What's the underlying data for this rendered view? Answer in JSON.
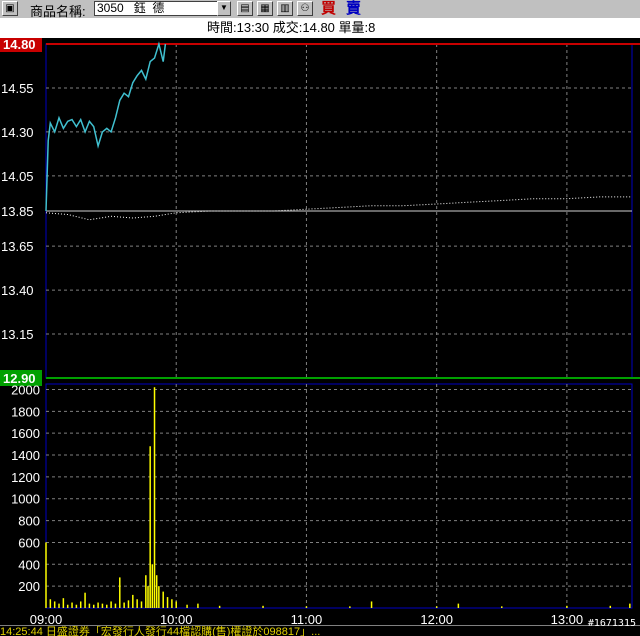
{
  "toolbar": {
    "label": "商品名稱:",
    "symbol_value": "3050   鈺  德",
    "buy_label": "買",
    "sell_label": "賣"
  },
  "info": {
    "text": "時間:13:30 成交:14.80 單量:8"
  },
  "ticker": {
    "text": "14:25:44 日盛證券「宏發行人發行44檔認購(售)權證於098817」..."
  },
  "watermark": "#1671315",
  "colors": {
    "upper_limit": "#c80000",
    "lower_limit": "#00a000",
    "price_line": "#40c0d0",
    "avg_line": "#ffffff",
    "volume": "#ffff00",
    "grid": "#808080"
  },
  "chart_data": [
    {
      "type": "line",
      "y_ticks": [
        "14.80",
        "14.55",
        "14.30",
        "14.05",
        "13.85",
        "13.65",
        "13.40",
        "13.15",
        "12.90"
      ],
      "ylim": [
        12.9,
        14.8
      ],
      "upper_limit": 14.8,
      "lower_limit": 12.9,
      "reference": 13.85,
      "x_ticks": [
        "09:00",
        "10:00",
        "11:00",
        "12:00",
        "13:00"
      ],
      "xlim": [
        "09:00",
        "13:30"
      ],
      "grid": true,
      "series": [
        {
          "x": [
            "09:00",
            "09:01",
            "09:02",
            "09:04",
            "09:06",
            "09:08",
            "09:10",
            "09:12",
            "09:14",
            "09:16",
            "09:18",
            "09:20",
            "09:22",
            "09:24",
            "09:26",
            "09:28",
            "09:30",
            "09:32",
            "09:34",
            "09:36",
            "09:38",
            "09:40",
            "09:42",
            "09:44",
            "09:46",
            "09:48",
            "09:50",
            "09:52",
            "09:54",
            "09:55"
          ],
          "values": [
            13.85,
            14.25,
            14.35,
            14.3,
            14.38,
            14.32,
            14.36,
            14.37,
            14.33,
            14.37,
            14.3,
            14.36,
            14.33,
            14.22,
            14.3,
            14.32,
            14.3,
            14.38,
            14.48,
            14.52,
            14.5,
            14.58,
            14.62,
            14.65,
            14.6,
            14.7,
            14.72,
            14.8,
            14.7,
            14.8
          ]
        },
        {
          "x": [
            "09:00",
            "09:10",
            "09:20",
            "09:30",
            "09:40",
            "09:50",
            "10:00",
            "10:15",
            "10:30",
            "10:45",
            "11:00",
            "11:15",
            "11:30",
            "11:45",
            "12:00",
            "12:15",
            "12:30",
            "12:45",
            "13:00",
            "13:15",
            "13:30"
          ],
          "values": [
            13.84,
            13.83,
            13.8,
            13.82,
            13.81,
            13.82,
            13.84,
            13.85,
            13.85,
            13.85,
            13.86,
            13.87,
            13.88,
            13.88,
            13.89,
            13.9,
            13.91,
            13.92,
            13.92,
            13.93,
            13.93
          ]
        }
      ]
    },
    {
      "type": "bar",
      "y_ticks": [
        "2000",
        "1800",
        "1600",
        "1400",
        "1200",
        "1000",
        "800",
        "600",
        "400",
        "200"
      ],
      "ylim": [
        0,
        2050
      ],
      "x_ticks": [
        "09:00",
        "10:00",
        "11:00",
        "12:00",
        "13:00"
      ],
      "grid": true,
      "bars": [
        {
          "x": "09:00",
          "v": 600
        },
        {
          "x": "09:02",
          "v": 80
        },
        {
          "x": "09:04",
          "v": 60
        },
        {
          "x": "09:06",
          "v": 40
        },
        {
          "x": "09:08",
          "v": 90
        },
        {
          "x": "09:10",
          "v": 30
        },
        {
          "x": "09:12",
          "v": 50
        },
        {
          "x": "09:14",
          "v": 30
        },
        {
          "x": "09:16",
          "v": 60
        },
        {
          "x": "09:18",
          "v": 140
        },
        {
          "x": "09:20",
          "v": 40
        },
        {
          "x": "09:22",
          "v": 30
        },
        {
          "x": "09:24",
          "v": 50
        },
        {
          "x": "09:26",
          "v": 40
        },
        {
          "x": "09:28",
          "v": 30
        },
        {
          "x": "09:30",
          "v": 60
        },
        {
          "x": "09:32",
          "v": 40
        },
        {
          "x": "09:34",
          "v": 280
        },
        {
          "x": "09:36",
          "v": 50
        },
        {
          "x": "09:38",
          "v": 70
        },
        {
          "x": "09:40",
          "v": 120
        },
        {
          "x": "09:42",
          "v": 80
        },
        {
          "x": "09:44",
          "v": 60
        },
        {
          "x": "09:46",
          "v": 300
        },
        {
          "x": "09:47",
          "v": 200
        },
        {
          "x": "09:48",
          "v": 1480
        },
        {
          "x": "09:49",
          "v": 400
        },
        {
          "x": "09:50",
          "v": 2020
        },
        {
          "x": "09:51",
          "v": 300
        },
        {
          "x": "09:52",
          "v": 200
        },
        {
          "x": "09:54",
          "v": 150
        },
        {
          "x": "09:56",
          "v": 100
        },
        {
          "x": "09:58",
          "v": 80
        },
        {
          "x": "10:00",
          "v": 60
        },
        {
          "x": "10:05",
          "v": 30
        },
        {
          "x": "10:10",
          "v": 40
        },
        {
          "x": "10:20",
          "v": 20
        },
        {
          "x": "10:40",
          "v": 20
        },
        {
          "x": "11:00",
          "v": 15
        },
        {
          "x": "11:20",
          "v": 15
        },
        {
          "x": "11:30",
          "v": 60
        },
        {
          "x": "12:00",
          "v": 15
        },
        {
          "x": "12:10",
          "v": 40
        },
        {
          "x": "12:30",
          "v": 15
        },
        {
          "x": "13:00",
          "v": 20
        },
        {
          "x": "13:20",
          "v": 20
        },
        {
          "x": "13:29",
          "v": 40
        }
      ]
    }
  ]
}
